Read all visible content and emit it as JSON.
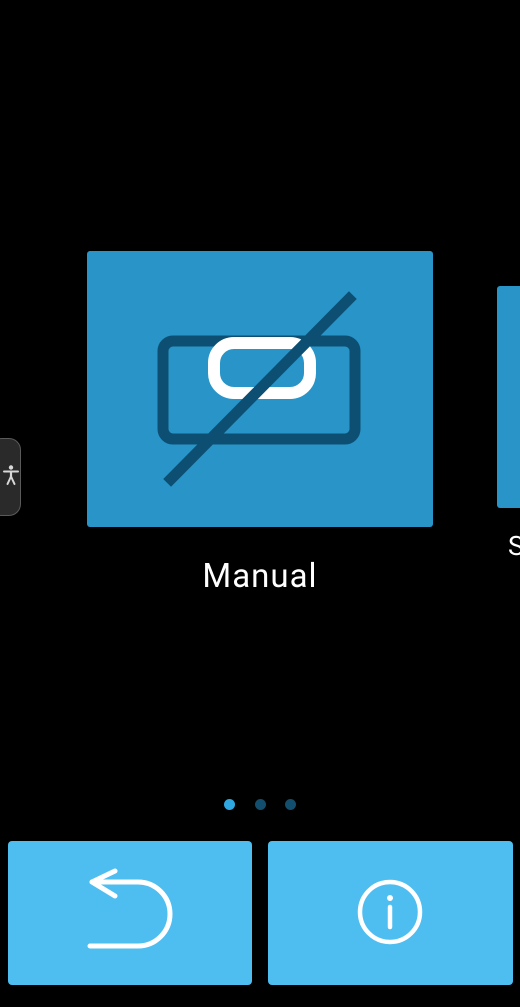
{
  "carousel": {
    "current_item_label": "Manual",
    "next_item_label": "S",
    "page_indicator": {
      "total": 3,
      "active_index": 0
    }
  },
  "icons": {
    "accessibility": "accessibility-person-icon",
    "card": "display-off-icon",
    "back": "undo-arrow-icon",
    "info": "info-circle-icon"
  },
  "colors": {
    "background": "#000000",
    "card": "#2894c8",
    "card_icon": "#0c4f72",
    "button": "#4ebdf0",
    "dot_active": "#2fa7e0",
    "dot_inactive": "#124e6d"
  }
}
